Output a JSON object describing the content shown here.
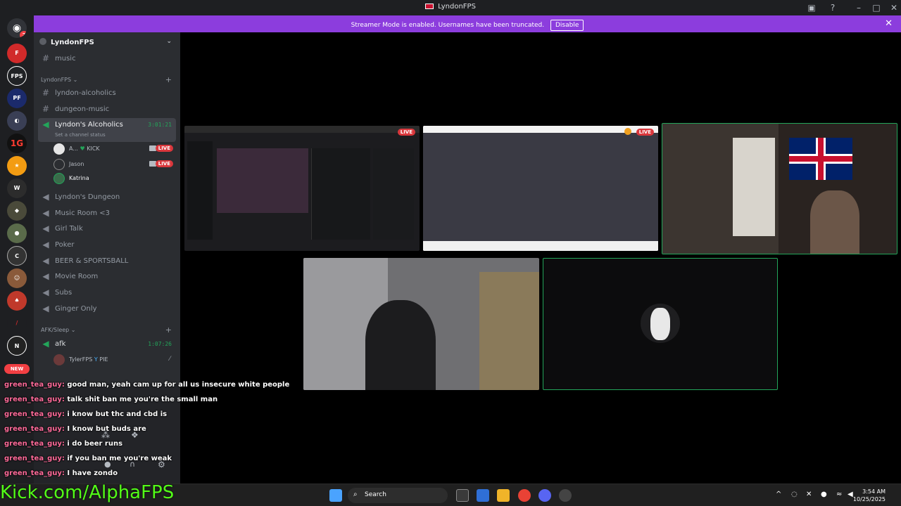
{
  "window": {
    "title": "LyndonFPS"
  },
  "banner": {
    "message": "Streamer Mode is enabled. Usernames have been truncated.",
    "disable_label": "Disable"
  },
  "rail": {
    "new_label": "NEW",
    "badge_count": "2"
  },
  "sidebar": {
    "server_name": "LyndonFPS",
    "top_channels": [
      {
        "name": "music",
        "icon": "hash-icon"
      }
    ],
    "category_lyndonfps": "LyndonFPS",
    "text_channels": [
      {
        "name": "lyndon-alcoholics"
      },
      {
        "name": "dungeon-music"
      }
    ],
    "active_voice": {
      "name": "Lyndon's Alcoholics",
      "timer": "3:01:21",
      "status": "Set a channel status"
    },
    "voice_users": [
      {
        "name": "A...",
        "tag": "KICK",
        "live": "LIVE"
      },
      {
        "name": "Jason",
        "tag": "",
        "live": "LIVE"
      },
      {
        "name": "Katrina",
        "tag": "",
        "live": ""
      }
    ],
    "voice_channels": [
      {
        "name": "Lyndon's Dungeon"
      },
      {
        "name": "Music Room <3"
      },
      {
        "name": "Girl Talk"
      },
      {
        "name": "Poker"
      },
      {
        "name": "BEER & SPORTSBALL"
      },
      {
        "name": "Movie Room"
      },
      {
        "name": "Subs"
      },
      {
        "name": "Ginger Only"
      }
    ],
    "category_afk": "AFK/Sleep",
    "afk": {
      "name": "afk",
      "timer": "1:07:26"
    },
    "afk_user": {
      "name": "TylerFPS",
      "tag": "PIE"
    }
  },
  "stage": {
    "live_label": "LIVE"
  },
  "chat": [
    {
      "user": "green_tea_guy:",
      "text": "good man, yeah cam up for all us insecure white people"
    },
    {
      "user": "green_tea_guy:",
      "text": "talk shit ban me you're the small man"
    },
    {
      "user": "green_tea_guy:",
      "text": "i know but thc and cbd is"
    },
    {
      "user": "green_tea_guy:",
      "text": "I know but buds are"
    },
    {
      "user": "green_tea_guy:",
      "text": "i do beer runs"
    },
    {
      "user": "green_tea_guy:",
      "text": "if you ban me you're weak"
    },
    {
      "user": "green_tea_guy:",
      "text": "I have zondo"
    }
  ],
  "watermark": "Kick.com/AlphaFPS",
  "taskbar": {
    "search_label": "Search",
    "time": "3:54 AM",
    "date": "10/25/2025"
  },
  "colors": {
    "banner": "#8c3ddd",
    "live": "#da373c",
    "kick_green": "#53fc18",
    "speaking_green": "#23a55a"
  }
}
